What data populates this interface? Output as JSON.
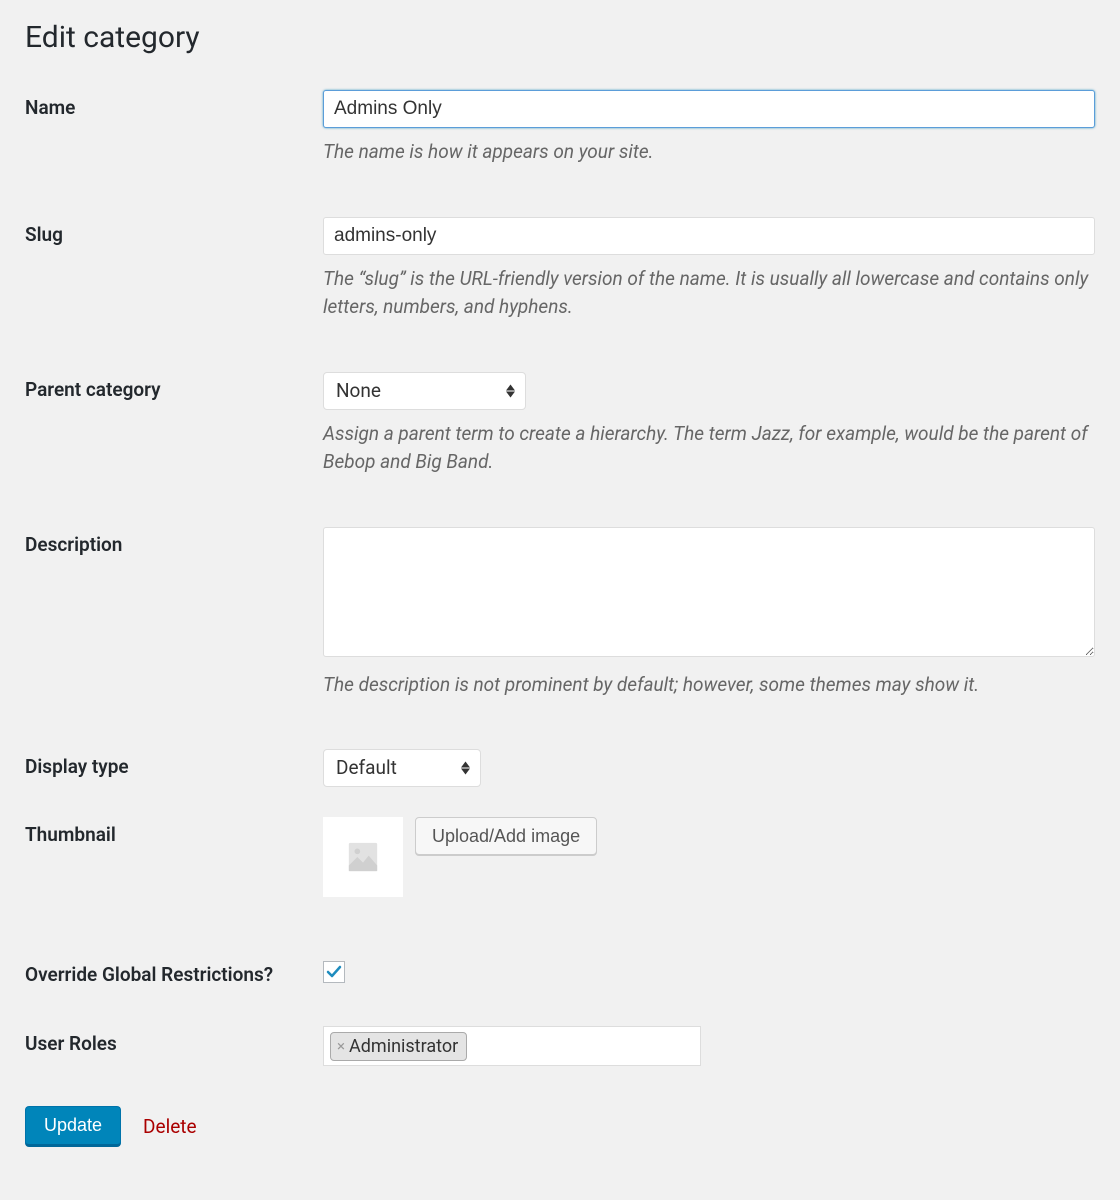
{
  "page_title": "Edit category",
  "fields": {
    "name": {
      "label": "Name",
      "value": "Admins Only",
      "description": "The name is how it appears on your site."
    },
    "slug": {
      "label": "Slug",
      "value": "admins-only",
      "description": "The “slug” is the URL-friendly version of the name. It is usually all lowercase and contains only letters, numbers, and hyphens."
    },
    "parent_category": {
      "label": "Parent category",
      "value": "None",
      "description": "Assign a parent term to create a hierarchy. The term Jazz, for example, would be the parent of Bebop and Big Band."
    },
    "description": {
      "label": "Description",
      "value": "",
      "help": "The description is not prominent by default; however, some themes may show it."
    },
    "display_type": {
      "label": "Display type",
      "value": "Default"
    },
    "thumbnail": {
      "label": "Thumbnail",
      "button": "Upload/Add image"
    },
    "override_restrictions": {
      "label": "Override Global Restrictions?",
      "checked": true
    },
    "user_roles": {
      "label": "User Roles",
      "tags": [
        "Administrator"
      ]
    }
  },
  "actions": {
    "update": "Update",
    "delete": "Delete"
  }
}
